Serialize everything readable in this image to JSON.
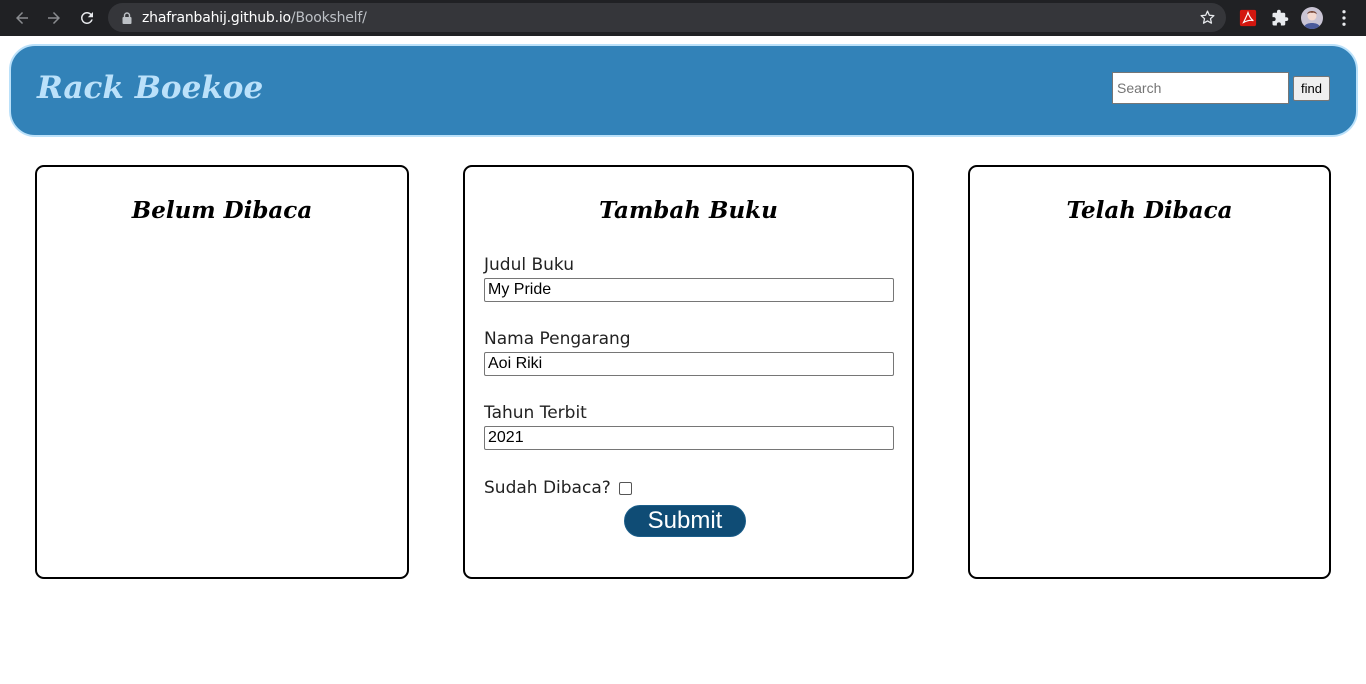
{
  "browser": {
    "url_host": "zhafranbahij.github.io",
    "url_path": "/Bookshelf/"
  },
  "header": {
    "brand": "Rack Boekoe",
    "search_placeholder": "Search",
    "find_label": "find"
  },
  "panels": {
    "unread_title": "Belum Dibaca",
    "add_title": "Tambah Buku",
    "read_title": "Telah Dibaca"
  },
  "form": {
    "title_label": "Judul Buku",
    "title_value": "My Pride",
    "author_label": "Nama Pengarang",
    "author_value": "Aoi Riki",
    "year_label": "Tahun Terbit",
    "year_value": "2021",
    "read_label": "Sudah Dibaca?",
    "read_checked": false,
    "submit_label": "Submit"
  },
  "colors": {
    "header_bg": "#3282b8",
    "brand_text": "#bbe1fa",
    "submit_bg": "#0f4c75",
    "chrome_bg": "#202124"
  },
  "icons": [
    "back-icon",
    "forward-icon",
    "reload-icon",
    "lock-icon",
    "star-icon",
    "pdf-extension-icon",
    "puzzle-icon",
    "profile-avatar-icon",
    "kebab-menu-icon"
  ]
}
